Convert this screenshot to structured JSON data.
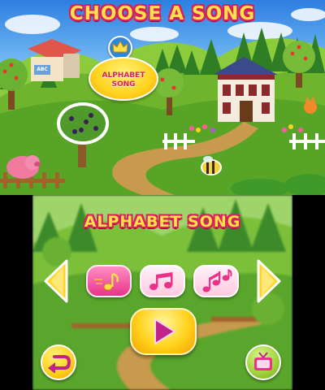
{
  "top_screen": {
    "title": "CHOOSE A SONG",
    "selected_song_label": "ALPHABET SONG",
    "house_sign": "ABC"
  },
  "bottom_screen": {
    "song_title": "ALPHABET SONG",
    "song_tiles": [
      {
        "icon": "single-note-icon",
        "selected": true
      },
      {
        "icon": "double-note-icon",
        "selected": false
      },
      {
        "icon": "beamed-notes-icon",
        "selected": false
      }
    ],
    "icons": {
      "prev": "arrow-left-icon",
      "next": "arrow-right-icon",
      "play": "play-icon",
      "back": "return-arrow-icon",
      "tv": "tv-icon"
    }
  },
  "colors": {
    "title_fill": "#ffe04a",
    "title_outline": "#d81e5b",
    "accent_pink": "#e9338a",
    "accent_yellow": "#ffd31e",
    "accent_green": "#9ed23a"
  }
}
